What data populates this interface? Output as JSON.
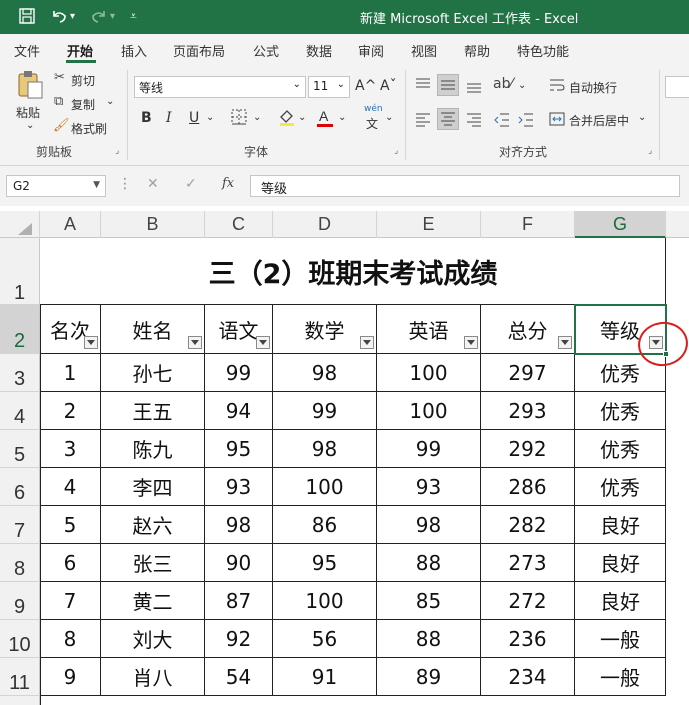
{
  "titlebar": {
    "title": "新建 Microsoft Excel 工作表  -  Excel",
    "save_icon": "save-icon",
    "undo_icon": "undo-icon",
    "redo_icon": "redo-icon",
    "customize_icon": "customize-qat-icon"
  },
  "tabs": [
    {
      "label": "文件"
    },
    {
      "label": "开始"
    },
    {
      "label": "插入"
    },
    {
      "label": "页面布局"
    },
    {
      "label": "公式"
    },
    {
      "label": "数据"
    },
    {
      "label": "审阅"
    },
    {
      "label": "视图"
    },
    {
      "label": "帮助"
    },
    {
      "label": "特色功能"
    }
  ],
  "ribbon": {
    "clipboard": {
      "paste": "粘贴",
      "cut": "剪切",
      "copy": "复制",
      "format_painter": "格式刷",
      "label": "剪贴板"
    },
    "font": {
      "name": "等线",
      "size": "11",
      "grow": "A^",
      "shrink": "Aˇ",
      "bold": "B",
      "italic": "I",
      "underline": "U",
      "wen": "wén",
      "wen_char": "文",
      "label": "字体",
      "font_color": "#e00000"
    },
    "alignment": {
      "wrap": "自动换行",
      "merge": "合并后居中",
      "label": "对齐方式"
    }
  },
  "formula_bar": {
    "name_box": "G2",
    "fx": "fx",
    "value": "等级"
  },
  "columns": [
    "A",
    "B",
    "C",
    "D",
    "E",
    "F",
    "G"
  ],
  "rows": [
    "1",
    "2",
    "3",
    "4",
    "5",
    "6",
    "7",
    "8",
    "9",
    "10",
    "11"
  ],
  "sheet": {
    "title": "三（2）班期末考试成绩",
    "headers": [
      "名次",
      "姓名",
      "语文",
      "数学",
      "英语",
      "总分",
      "等级"
    ],
    "data": [
      [
        "1",
        "孙七",
        "99",
        "98",
        "100",
        "297",
        "优秀"
      ],
      [
        "2",
        "王五",
        "94",
        "99",
        "100",
        "293",
        "优秀"
      ],
      [
        "3",
        "陈九",
        "95",
        "98",
        "99",
        "292",
        "优秀"
      ],
      [
        "4",
        "李四",
        "93",
        "100",
        "93",
        "286",
        "优秀"
      ],
      [
        "5",
        "赵六",
        "98",
        "86",
        "98",
        "282",
        "良好"
      ],
      [
        "6",
        "张三",
        "90",
        "95",
        "88",
        "273",
        "良好"
      ],
      [
        "7",
        "黄二",
        "87",
        "100",
        "85",
        "272",
        "良好"
      ],
      [
        "8",
        "刘大",
        "92",
        "56",
        "88",
        "236",
        "一般"
      ],
      [
        "9",
        "肖八",
        "54",
        "91",
        "89",
        "234",
        "一般"
      ]
    ]
  },
  "colors": {
    "accent": "#217346",
    "annotation": "#d62020"
  }
}
